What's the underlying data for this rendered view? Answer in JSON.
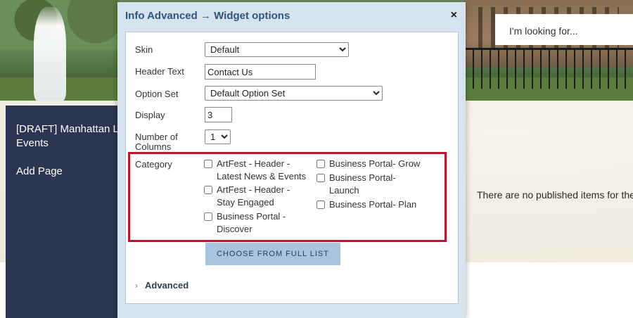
{
  "search": {
    "placeholder": "I'm looking for..."
  },
  "sidebar": {
    "draft_title": "[DRAFT] Manhattan L Events",
    "add_page": "Add Page"
  },
  "page": {
    "empty_message": "There are no published items for the as Advanced)"
  },
  "modal": {
    "title": "Info Advanced → Widget options",
    "close_glyph": "×",
    "fields": {
      "skin": {
        "label": "Skin",
        "value": "Default"
      },
      "header_text": {
        "label": "Header Text",
        "value": "Contact Us"
      },
      "option_set": {
        "label": "Option Set",
        "value": "Default Option Set"
      },
      "display": {
        "label": "Display",
        "value": "3"
      },
      "number_of_columns": {
        "label": "Number of Columns",
        "value": "1"
      }
    },
    "category": {
      "label": "Category",
      "items": [
        {
          "label": "ArtFest - Header - Latest News & Events",
          "checked": false
        },
        {
          "label": "ArtFest - Header - Stay Engaged",
          "checked": false
        },
        {
          "label": "Business Portal - Discover",
          "checked": false
        },
        {
          "label": "Business Portal- Grow",
          "checked": false
        },
        {
          "label": "Business Portal- Launch",
          "checked": false
        },
        {
          "label": "Business Portal- Plan",
          "checked": false
        }
      ]
    },
    "choose_button": "CHOOSE FROM FULL LIST",
    "advanced": {
      "chevron": "›",
      "label": "Advanced"
    }
  },
  "colors": {
    "sidebar": "#2c3551",
    "modal_bg": "#d6e2ee",
    "title": "#2d5680",
    "highlight": "#c0102a",
    "button": "#a9c4e0"
  }
}
